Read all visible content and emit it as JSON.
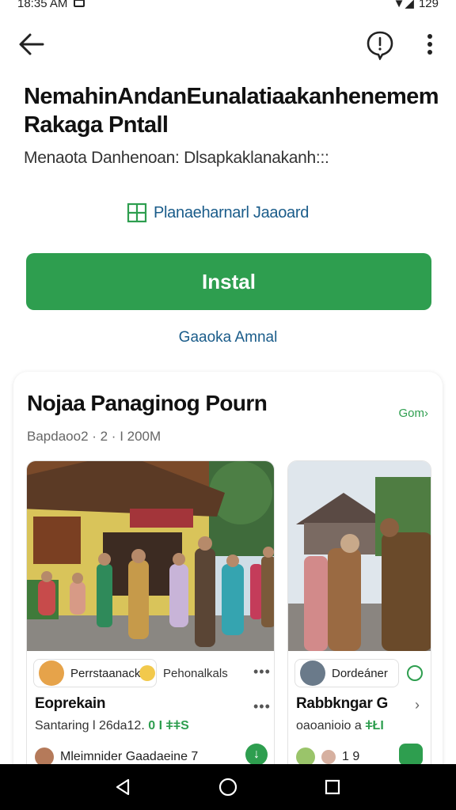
{
  "status_bar": {
    "time": "18:35 AM",
    "battery": "129"
  },
  "app": {
    "title": "NemahinAndanEunalatiaakanhenemem Rakaga Pntall",
    "subtitle": "Menaota Danhenoan: Dlsapkaklanakanh:::",
    "desktop_link": "Planaeharnarl Jaaoard",
    "install_label": "Instal",
    "secondary_link": "Gaaoka Amnal"
  },
  "card": {
    "title": "Nojaa Panaginog Pourn",
    "more_label": "Gom",
    "meta": "Bapdaoo2 · 2 · I 200M",
    "posts": [
      {
        "author": "Perrstaanackt",
        "badge": "Pehonalkals",
        "title": "Eoprekain",
        "subtitle_text": "Santaring l 26da12.",
        "subtitle_highlight": "0 I ǂǂS",
        "footer": "Mleimnider Gaadaeine 7"
      },
      {
        "author": "Dordeáner",
        "title": "Rabbkngar G",
        "subtitle_text": "oaoanioio a",
        "subtitle_highlight": "ǂŁI",
        "footer": "1 9"
      }
    ]
  },
  "colors": {
    "accent": "#2e9e4f",
    "link": "#1a5c8a"
  },
  "icons": [
    "back-icon",
    "feedback-icon",
    "more-vert-icon",
    "desktop-icon",
    "arrow-right-icon",
    "download-icon",
    "nav-back-icon",
    "nav-home-icon",
    "nav-recents-icon"
  ]
}
